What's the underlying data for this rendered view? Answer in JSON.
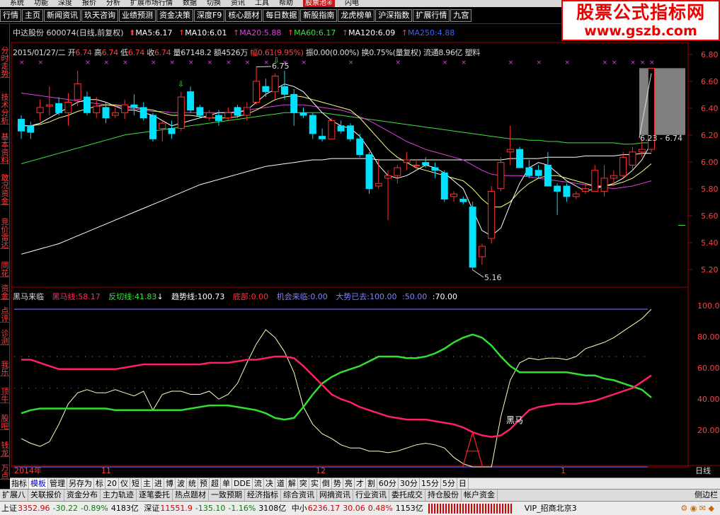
{
  "menubar": [
    "系统",
    "功能",
    "深度",
    "报价",
    "分析",
    "扩展市场行情",
    "数据",
    "切换",
    "资讯",
    "工具",
    "帮助"
  ],
  "menubar_hot": "股票池④",
  "menubar_right": "闪电",
  "tabs": [
    {
      "label": "行情",
      "style": "normal"
    },
    {
      "label": "主页",
      "style": "normal"
    },
    {
      "label": "新闻资讯",
      "style": "normal"
    },
    {
      "label": "玖天咨询",
      "style": "normal"
    },
    {
      "label": "业绩预测",
      "style": "normal"
    },
    {
      "label": "资金决策",
      "style": "normal"
    },
    {
      "label": "深度F9",
      "style": "normal"
    },
    {
      "label": "核心题材",
      "style": "normal"
    },
    {
      "label": "每日数据",
      "style": "normal"
    },
    {
      "label": "新股指南",
      "style": "normal"
    },
    {
      "label": "龙虎榜单",
      "style": "normal"
    },
    {
      "label": "沪深指数",
      "style": "normal"
    },
    {
      "label": "扩展行情",
      "style": "normal"
    },
    {
      "label": "九宫",
      "style": "normal"
    }
  ],
  "logo": {
    "line1": "股票公式指标网",
    "line2": "www.gszb.com"
  },
  "left_sidebar": [
    "分时走势",
    "技术分析",
    "基本资料",
    "敢况资金",
    "竞价雷达",
    "同花",
    "资金",
    "点评",
    "诊测",
    "我乐",
    "顶牛",
    "股吧",
    "钱龙",
    "万点"
  ],
  "stock_header": {
    "name": "中达股份",
    "code": "600074",
    "mode": "(日线,前复权)",
    "ma": [
      {
        "label": "MA5:",
        "value": "6.17",
        "color": "#ffffff"
      },
      {
        "label": "MA10:",
        "value": "6.01",
        "color": "#ffffff"
      },
      {
        "label": "MA20:",
        "value": "5.88",
        "color": "#e040e0"
      },
      {
        "label": "MA60:",
        "value": "6.17",
        "color": "#40e040"
      },
      {
        "label": "MA120:",
        "value": "6.09",
        "color": "#ffffff"
      },
      {
        "label": "MA250:",
        "value": "4.88",
        "color": "#4060ff"
      }
    ]
  },
  "quote_line": {
    "date": "2015/01/27/二",
    "open_label": "开",
    "open": "6.74",
    "high_label": "高",
    "high": "6.74",
    "low_label": "低",
    "low": "6.74",
    "close_label": "收",
    "close": "6.74",
    "vol_label": "量",
    "vol": "67148.2",
    "amt_label": "额",
    "amt": "4526万",
    "chg_label": "幅",
    "chg": "0.61(9.95%)",
    "amp_label": "振",
    "amp": "0.00(0.00%)",
    "turn_label": "换",
    "turn": "0.75%(量复权)",
    "float_label": "流通",
    "float": "8.96亿",
    "concept": "塑料"
  },
  "price_annotations": {
    "high": "6.75",
    "low": "5.16",
    "range": "6.23 - 6.74"
  },
  "price_axis": [
    "6.80",
    "6.60",
    "6.40",
    "6.20",
    "6.00",
    "5.80",
    "5.60",
    "5.40",
    "5.20"
  ],
  "indicator": {
    "name": "黑马来临",
    "items": [
      {
        "label": "黑马线:",
        "value": "58.17",
        "color": "#ff3060"
      },
      {
        "label": "反切线:",
        "value": "41.83",
        "color": "#40e040"
      },
      {
        "label": "趋势线:",
        "value": "100.73",
        "color": "#ffffff"
      },
      {
        "label": "底部:",
        "value": "0.00",
        "color": "#ff3030"
      },
      {
        "label": "机会来临:",
        "value": "0.00",
        "color": "#8080ff"
      },
      {
        "label": "大势已去:",
        "value": "100.00",
        "color": "#8080ff"
      },
      {
        "label": ":",
        "value": "50.00",
        "color": "#8080ff"
      },
      {
        "label": ":",
        "value": "70.00",
        "color": "#ffffff"
      }
    ],
    "axis": [
      "100.0",
      "80.00",
      "60.00",
      "40.00",
      "20.00"
    ],
    "signal_label": "黑马"
  },
  "date_axis": {
    "year": "2014年",
    "m11": "11",
    "m12": "12",
    "m1": "1",
    "period": "日线"
  },
  "bottom_tabs": [
    "指标",
    "模板",
    "管理",
    "另存为",
    "标",
    "20",
    "仪",
    "短",
    "主",
    "进",
    "博",
    "波",
    "统",
    "预",
    "超",
    "单",
    "DDE",
    "流",
    "决",
    "道",
    "解",
    "突",
    "实",
    "倒",
    "势",
    "亮",
    "才",
    "割",
    "60分",
    "30分",
    "15分",
    "5分",
    "日"
  ],
  "bottom_tab_selected": "模板",
  "func_bar": [
    "扩展八",
    "关联报价",
    "资金分布",
    "主力轨迹",
    "逐笔委托",
    "热点题材",
    "一致预期",
    "经济指标",
    "综合资讯",
    "网摘资讯",
    "行业资讯",
    "委托成交",
    "持仓股份",
    "帐户资金"
  ],
  "func_bar_right": "侧边栏",
  "status": {
    "sh_label": "上证",
    "sh": "3352.96",
    "sh_chg": "-30.22",
    "sh_pct": "-0.89%",
    "sh_amt": "4183亿",
    "sz_label": "深证",
    "sz": "11551.9",
    "sz_chg": "-135.10",
    "sz_pct": "-1.16%",
    "sz_amt": "3108亿",
    "zx_label": "中小",
    "zx": "6236.17",
    "zx_chg": "30.06",
    "zx_pct": "0.48%",
    "zx_amt": "1153亿",
    "vip": "VIP_招商北京3"
  },
  "colors": {
    "up": "#ff3030",
    "down": "#00e0ff",
    "ma5": "#ffffff",
    "ma10": "#ffff80",
    "ma20": "#e040e0",
    "ma60": "#40e040",
    "ma120": "#ffffff"
  },
  "chart_data": {
    "type": "candlestick",
    "ylim": [
      5.1,
      6.85
    ],
    "candles": [
      [
        6.35,
        6.38,
        6.2,
        6.26
      ],
      [
        6.3,
        6.33,
        6.2,
        6.25
      ],
      [
        6.4,
        6.5,
        6.34,
        6.44
      ],
      [
        6.45,
        6.6,
        6.38,
        6.46
      ],
      [
        6.47,
        6.52,
        6.38,
        6.4
      ],
      [
        6.4,
        6.55,
        6.3,
        6.48
      ],
      [
        6.5,
        6.72,
        6.45,
        6.62
      ],
      [
        6.52,
        6.56,
        6.38,
        6.4
      ],
      [
        6.4,
        6.52,
        6.36,
        6.45
      ],
      [
        6.44,
        6.48,
        6.32,
        6.36
      ],
      [
        6.38,
        6.44,
        6.36,
        6.4
      ],
      [
        6.4,
        6.5,
        6.35,
        6.46
      ],
      [
        6.46,
        6.54,
        6.38,
        6.44
      ],
      [
        6.44,
        6.48,
        6.34,
        6.36
      ],
      [
        6.38,
        6.4,
        6.18,
        6.2
      ],
      [
        6.28,
        6.34,
        6.18,
        6.32
      ],
      [
        6.28,
        6.34,
        6.2,
        6.24
      ],
      [
        6.28,
        6.56,
        6.26,
        6.52
      ],
      [
        6.56,
        6.6,
        6.4,
        6.42
      ],
      [
        6.44,
        6.46,
        6.36,
        6.38
      ],
      [
        6.36,
        6.42,
        6.34,
        6.4
      ],
      [
        6.38,
        6.42,
        6.3,
        6.34
      ],
      [
        6.36,
        6.44,
        6.34,
        6.4
      ],
      [
        6.44,
        6.46,
        6.36,
        6.38
      ],
      [
        6.38,
        6.48,
        6.34,
        6.44
      ],
      [
        6.48,
        6.75,
        6.46,
        6.64
      ],
      [
        6.6,
        6.66,
        6.52,
        6.56
      ],
      [
        6.56,
        6.7,
        6.5,
        6.68
      ],
      [
        6.6,
        6.72,
        6.5,
        6.54
      ],
      [
        6.54,
        6.58,
        6.3,
        6.4
      ],
      [
        6.4,
        6.44,
        6.36,
        6.38
      ],
      [
        6.38,
        6.4,
        6.2,
        6.24
      ],
      [
        6.22,
        6.28,
        6.18,
        6.2
      ],
      [
        6.2,
        6.36,
        6.2,
        6.34
      ],
      [
        6.3,
        6.34,
        6.24,
        6.26
      ],
      [
        6.3,
        6.32,
        6.18,
        6.2
      ],
      [
        6.2,
        6.24,
        6.06,
        6.08
      ],
      [
        6.08,
        6.1,
        5.78,
        5.82
      ],
      [
        5.84,
        6.04,
        5.82,
        5.86
      ],
      [
        5.9,
        5.96,
        5.58,
        5.92
      ],
      [
        5.92,
        6.0,
        5.86,
        5.98
      ],
      [
        6.02,
        6.1,
        5.96,
        6.04
      ],
      [
        6.0,
        6.04,
        5.96,
        6.0
      ],
      [
        6.02,
        6.06,
        5.98,
        6.0
      ],
      [
        5.98,
        6.02,
        5.9,
        5.96
      ],
      [
        5.94,
        5.96,
        5.72,
        5.74
      ],
      [
        5.76,
        5.8,
        5.72,
        5.78
      ],
      [
        5.74,
        5.76,
        5.7,
        5.72
      ],
      [
        5.68,
        5.72,
        5.2,
        5.22
      ],
      [
        5.3,
        5.4,
        5.24,
        5.38
      ],
      [
        5.44,
        5.84,
        5.4,
        5.8
      ],
      [
        5.82,
        6.06,
        5.8,
        6.02
      ],
      [
        6.1,
        6.3,
        6.0,
        6.12
      ],
      [
        6.12,
        6.14,
        5.98,
        5.98
      ],
      [
        5.98,
        6.04,
        5.9,
        5.92
      ],
      [
        5.96,
        6.0,
        5.9,
        5.92
      ],
      [
        6.0,
        6.1,
        5.84,
        5.84
      ],
      [
        5.84,
        5.86,
        5.62,
        5.8
      ],
      [
        5.84,
        5.86,
        5.72,
        5.76
      ],
      [
        5.76,
        5.8,
        5.74,
        5.78
      ],
      [
        5.8,
        5.86,
        5.78,
        5.82
      ],
      [
        5.8,
        6.0,
        5.8,
        5.96
      ],
      [
        5.8,
        6.0,
        5.76,
        5.9
      ],
      [
        5.9,
        5.96,
        5.84,
        5.92
      ],
      [
        5.92,
        6.1,
        5.9,
        6.06
      ],
      [
        6.0,
        6.14,
        5.96,
        6.1
      ],
      [
        6.1,
        6.2,
        6.06,
        6.12
      ],
      [
        6.12,
        6.74,
        6.1,
        6.74
      ]
    ],
    "ma5": [
      6.3,
      6.3,
      6.32,
      6.36,
      6.4,
      6.44,
      6.48,
      6.5,
      6.5,
      6.48,
      6.45,
      6.42,
      6.42,
      6.4,
      6.38,
      6.34,
      6.3,
      6.32,
      6.34,
      6.36,
      6.38,
      6.4,
      6.4,
      6.4,
      6.42,
      6.48,
      6.54,
      6.58,
      6.62,
      6.6,
      6.56,
      6.48,
      6.4,
      6.34,
      6.3,
      6.28,
      6.22,
      6.12,
      6.0,
      5.92,
      5.9,
      5.92,
      5.96,
      6.0,
      5.98,
      5.94,
      5.88,
      5.82,
      5.66,
      5.5,
      5.46,
      5.52,
      5.7,
      5.86,
      5.98,
      6.02,
      6.0,
      5.94,
      5.88,
      5.84,
      5.8,
      5.82,
      5.84,
      5.86,
      5.9,
      5.96,
      6.04,
      6.17
    ],
    "ma10": [
      6.3,
      6.3,
      6.31,
      6.33,
      6.36,
      6.38,
      6.41,
      6.43,
      6.45,
      6.46,
      6.46,
      6.45,
      6.44,
      6.43,
      6.42,
      6.4,
      6.38,
      6.38,
      6.38,
      6.37,
      6.36,
      6.36,
      6.36,
      6.37,
      6.39,
      6.42,
      6.46,
      6.5,
      6.52,
      6.53,
      6.52,
      6.5,
      6.48,
      6.46,
      6.44,
      6.42,
      6.36,
      6.28,
      6.2,
      6.12,
      6.06,
      6.02,
      5.98,
      5.96,
      5.94,
      5.92,
      5.9,
      5.88,
      5.82,
      5.74,
      5.68,
      5.68,
      5.72,
      5.8,
      5.86,
      5.9,
      5.92,
      5.92,
      5.9,
      5.88,
      5.86,
      5.84,
      5.84,
      5.85,
      5.87,
      5.9,
      5.95,
      6.01
    ],
    "ma20": [
      6.55,
      6.54,
      6.53,
      6.52,
      6.51,
      6.5,
      6.49,
      6.48,
      6.47,
      6.46,
      6.45,
      6.44,
      6.43,
      6.42,
      6.41,
      6.41,
      6.4,
      6.4,
      6.4,
      6.4,
      6.4,
      6.4,
      6.4,
      6.41,
      6.42,
      6.43,
      6.44,
      6.45,
      6.46,
      6.46,
      6.46,
      6.45,
      6.44,
      6.43,
      6.42,
      6.4,
      6.37,
      6.34,
      6.3,
      6.26,
      6.22,
      6.18,
      6.15,
      6.12,
      6.1,
      6.08,
      6.06,
      6.04,
      6.0,
      5.96,
      5.93,
      5.92,
      5.92,
      5.92,
      5.91,
      5.9,
      5.89,
      5.88,
      5.87,
      5.86,
      5.85,
      5.84,
      5.83,
      5.82,
      5.83,
      5.84,
      5.86,
      5.88
    ],
    "ma60": [
      6.01,
      6.03,
      6.05,
      6.07,
      6.09,
      6.11,
      6.13,
      6.15,
      6.17,
      6.19,
      6.21,
      6.23,
      6.24,
      6.25,
      6.26,
      6.27,
      6.28,
      6.29,
      6.3,
      6.31,
      6.32,
      6.33,
      6.34,
      6.35,
      6.36,
      6.37,
      6.38,
      6.39,
      6.4,
      6.4,
      6.4,
      6.4,
      6.4,
      6.39,
      6.38,
      6.37,
      6.36,
      6.35,
      6.34,
      6.33,
      6.32,
      6.31,
      6.3,
      6.29,
      6.28,
      6.27,
      6.26,
      6.25,
      6.24,
      6.23,
      6.22,
      6.21,
      6.2,
      6.2,
      6.19,
      6.19,
      6.18,
      6.18,
      6.17,
      6.17,
      6.17,
      6.17,
      6.17,
      6.17,
      6.16,
      6.16,
      6.17,
      6.17
    ],
    "ma120": [
      5.32,
      5.34,
      5.36,
      5.38,
      5.4,
      5.43,
      5.46,
      5.49,
      5.52,
      5.55,
      5.58,
      5.61,
      5.64,
      5.67,
      5.7,
      5.73,
      5.76,
      5.79,
      5.82,
      5.85,
      5.87,
      5.89,
      5.91,
      5.93,
      5.95,
      5.97,
      5.99,
      6.0,
      6.01,
      6.02,
      6.03,
      6.04,
      6.04,
      6.05,
      6.05,
      6.05,
      6.05,
      6.05,
      6.04,
      6.04,
      6.04,
      6.04,
      6.04,
      6.04,
      6.04,
      6.04,
      6.04,
      6.04,
      6.04,
      6.04,
      6.04,
      6.04,
      6.05,
      6.05,
      6.05,
      6.05,
      6.06,
      6.06,
      6.06,
      6.06,
      6.07,
      6.07,
      6.07,
      6.07,
      6.08,
      6.08,
      6.09,
      6.09
    ],
    "ind_ylim": [
      0,
      105
    ],
    "heima": [
      68,
      68,
      66,
      64,
      62,
      62,
      62,
      62,
      62,
      62,
      62,
      63,
      64,
      65,
      65,
      65,
      65,
      65,
      65,
      65,
      66,
      66,
      66,
      67,
      68,
      68,
      69,
      70,
      70,
      69,
      64,
      58,
      52,
      46,
      43,
      41,
      38,
      36,
      34,
      32,
      31,
      30,
      30,
      30,
      29,
      28,
      27,
      25,
      22,
      20,
      19,
      20,
      24,
      30,
      36,
      38,
      39,
      40,
      40,
      40,
      41,
      42,
      44,
      46,
      48,
      50,
      54,
      58
    ],
    "fanqie": [
      34,
      36,
      37,
      37,
      37,
      37,
      37,
      37,
      37,
      37,
      36,
      36,
      36,
      36,
      36,
      36,
      36,
      36,
      37,
      38,
      39,
      39,
      39,
      38,
      37,
      36,
      34,
      31,
      30,
      31,
      38,
      46,
      53,
      57,
      60,
      62,
      64,
      67,
      70,
      70,
      70,
      69,
      69,
      70,
      72,
      75,
      79,
      82,
      84,
      82,
      77,
      70,
      64,
      60,
      60,
      60,
      60,
      60,
      60,
      59,
      58,
      58,
      56,
      55,
      53,
      51,
      49,
      44
    ],
    "qushi": [
      18,
      15,
      13,
      16,
      27,
      40,
      47,
      49,
      47,
      47,
      49,
      47,
      45,
      48,
      36,
      46,
      48,
      48,
      46,
      46,
      48,
      43,
      46,
      53,
      66,
      78,
      87,
      82,
      73,
      60,
      38,
      27,
      21,
      18,
      14,
      12,
      12,
      10,
      10,
      9,
      10,
      12,
      14,
      15,
      14,
      12,
      6,
      2,
      0,
      0,
      0,
      32,
      55,
      66,
      69,
      68,
      69,
      69,
      68,
      70,
      75,
      77,
      79,
      82,
      86,
      90,
      94,
      100
    ],
    "signal_index": 48
  }
}
